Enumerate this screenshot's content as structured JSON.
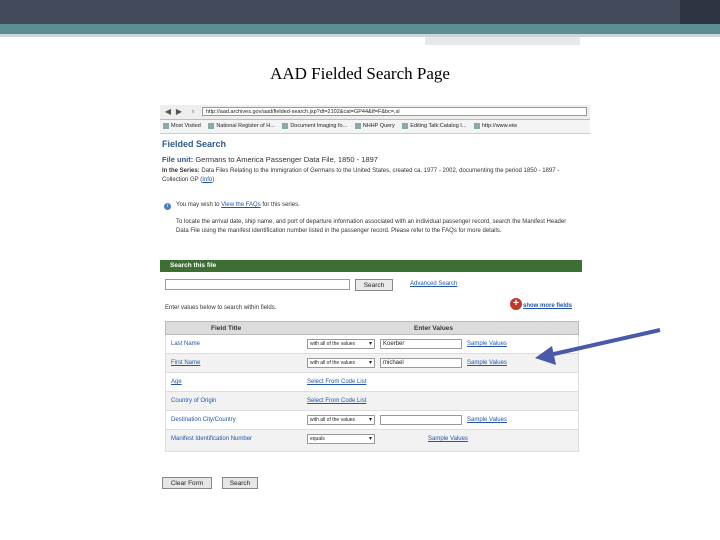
{
  "slide": {
    "title": "AAD Fielded Search Page"
  },
  "browser": {
    "url": "http://aad.archives.gov/aad/fielded-search.jsp?dt=2102&cat=GP44&tf=F&bc=,sl",
    "back_icon": "back-arrow-icon",
    "forward_icon": "forward-arrow-icon",
    "bookmarks": [
      "Most Visited",
      "National Register of H...",
      "Document Imaging fo...",
      "NHHP Query",
      "Editing Talk:Catalog I...",
      "http://www.eiw"
    ]
  },
  "page": {
    "heading": "Fielded Search",
    "file_unit_label": "File unit:",
    "file_unit_value": "Germans to America Passenger Data File, 1850 - 1897",
    "series_label": "In the Series:",
    "series_text": "Data Files Relating to the Immigration of Germans to the United States, created ca. 1977 - 2002, documenting the period 1850 - 1897 - Collection GP",
    "info_link": "Info",
    "tip_prefix": "You may wish to",
    "tip_link": "View the FAQs",
    "tip_suffix": "for this series.",
    "info_paragraph": "To locate the arrival date, ship name, and port of departure information associated with an individual passenger record, search the Manifest Header Data File using the manifest identification number listed in the passenger record. Please refer to the FAQs for more details."
  },
  "search": {
    "panel_title": "Search this file",
    "button_label": "Search",
    "advanced_link": "Advanced Search",
    "enter_values_text": "Enter values below to search within fields.",
    "show_more_label": "show more fields",
    "col_field_title": "Field Title",
    "col_enter_values": "Enter Values",
    "rows": [
      {
        "field": "Last Name",
        "operator": "with all of the values",
        "value": "Koerber",
        "link": "Sample Values"
      },
      {
        "field": "First Name",
        "operator": "with all of the values",
        "value": "michael",
        "link": "Sample Values"
      },
      {
        "field": "Age",
        "code_link": "Select From Code List"
      },
      {
        "field": "Country of Origin",
        "code_link": "Select From Code List"
      },
      {
        "field": "Destination City/Country",
        "operator": "with all of the values",
        "value": "",
        "link": "Sample Values"
      },
      {
        "field": "Manifest Identification Number",
        "operator": "equals",
        "link": "Sample Values"
      }
    ],
    "clear_button": "Clear Form",
    "submit_button": "Search"
  },
  "colors": {
    "panel_green": "#3d6e34",
    "link_blue": "#2255aa",
    "heading_blue": "#2c5a8a",
    "arrow": "#4a5aa8"
  }
}
